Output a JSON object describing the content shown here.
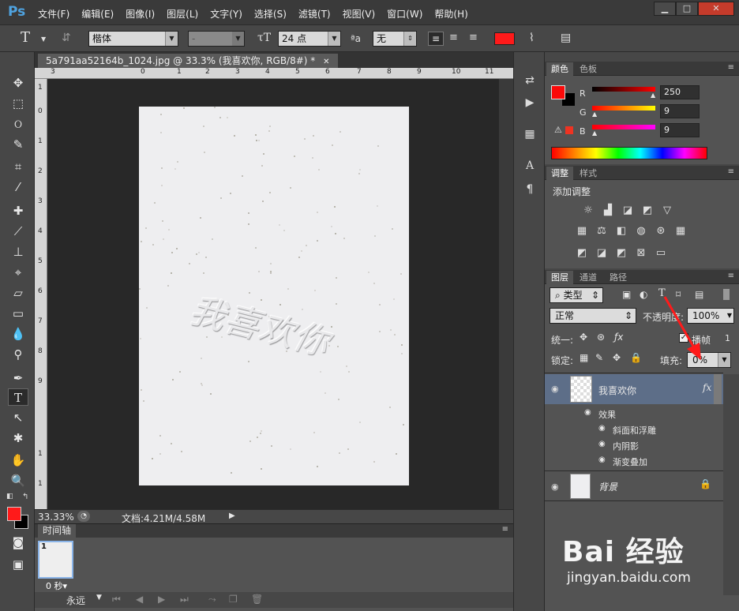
{
  "app": {
    "logo": "Ps",
    "menu": [
      "文件(F)",
      "编辑(E)",
      "图像(I)",
      "图层(L)",
      "文字(Y)",
      "选择(S)",
      "滤镜(T)",
      "视图(V)",
      "窗口(W)",
      "帮助(H)"
    ],
    "window_buttons": [
      "▁",
      "□",
      "✕"
    ]
  },
  "options": {
    "tool_icon": "T",
    "font_family": "楷体",
    "font_style": "-",
    "font_size": "24 点",
    "aa_label": "ªa",
    "anti_alias": "无",
    "text_color": "#ff1a1a"
  },
  "document": {
    "tab_title": "5a791aa52164b_1024.jpg @ 33.3% (我喜欢你, RGB/8#) *",
    "tab_close": "✕",
    "embossed_text": "我喜欢你",
    "ruler_top": [
      "3",
      "0",
      "1",
      "2",
      "3",
      "4",
      "5",
      "6",
      "7",
      "8",
      "9",
      "10",
      "11"
    ],
    "ruler_left": [
      "1",
      "0",
      "1",
      "2",
      "3",
      "4",
      "5",
      "6",
      "7",
      "8",
      "9",
      "1",
      "1"
    ]
  },
  "status": {
    "zoom": "33.33%",
    "doc_size": "文档:4.21M/4.58M"
  },
  "timeline": {
    "title": "时间轴",
    "frame_number": "1",
    "frame_delay": "0 秒▾",
    "loop": "永远"
  },
  "color_panel": {
    "tabs": [
      "颜色",
      "色板"
    ],
    "r_label": "R",
    "r_value": "250",
    "g_label": "G",
    "g_value": "9",
    "b_label": "B",
    "b_value": "9",
    "foreground": "#fa0909"
  },
  "adjust_panel": {
    "tabs": [
      "调整",
      "样式"
    ],
    "title": "添加调整"
  },
  "layers_panel": {
    "tabs": [
      "图层",
      "通道",
      "路径"
    ],
    "filter": "类型",
    "blend_mode": "正常",
    "opacity_label": "不透明度:",
    "opacity": "100%",
    "unify_label": "统一:",
    "propagate_label": "播帧",
    "propagate_value": "1",
    "lock_label": "锁定:",
    "fill_label": "填充:",
    "fill": "0%",
    "layers": [
      {
        "name": "我喜欢你",
        "fx": "fx"
      },
      {
        "name": "背景"
      }
    ],
    "effects_label": "效果",
    "effects": [
      "斜面和浮雕",
      "内阴影",
      "渐变叠加"
    ]
  },
  "watermark": {
    "brand": "Bai 经验",
    "url": "jingyan.baidu.com"
  }
}
